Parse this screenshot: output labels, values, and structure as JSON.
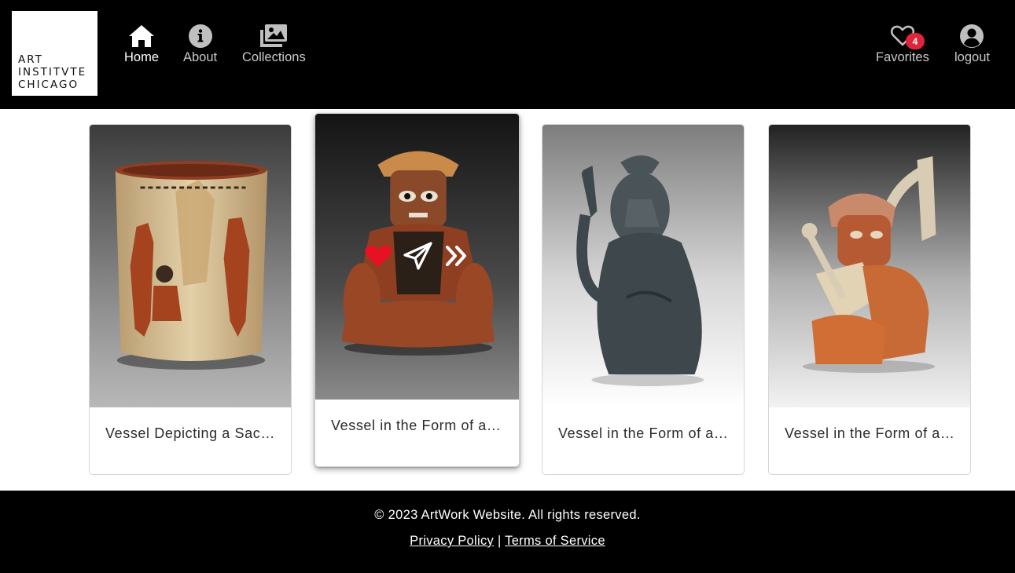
{
  "header": {
    "logo_lines": [
      "ART",
      "INSTITVTE",
      "CHICAGO"
    ],
    "nav": [
      {
        "label": "Home",
        "icon": "home-icon",
        "active": true
      },
      {
        "label": "About",
        "icon": "info-icon",
        "active": false
      },
      {
        "label": "Collections",
        "icon": "images-icon",
        "active": false
      }
    ],
    "favorites": {
      "label": "Favorites",
      "count": "4",
      "icon": "heart-icon"
    },
    "logout": {
      "label": "logout",
      "icon": "user-circle-icon"
    }
  },
  "cards": [
    {
      "title": "Vessel Depicting a Sacrificial Scene"
    },
    {
      "title": "Vessel in the Form of a Seated Figure"
    },
    {
      "title": "Vessel in the Form of a Seated Figure"
    },
    {
      "title": "Vessel in the Form of a Warrior"
    }
  ],
  "card_actions": {
    "favorite_icon": "heart-filled-icon",
    "share_icon": "paper-plane-icon",
    "details_icon": "double-chevron-right-icon",
    "favorite_color": "#e81123"
  },
  "footer": {
    "copyright": "© 2023 ArtWork Website. All rights reserved.",
    "privacy": "Privacy Policy",
    "separator": "|",
    "terms": "Terms of Service"
  }
}
